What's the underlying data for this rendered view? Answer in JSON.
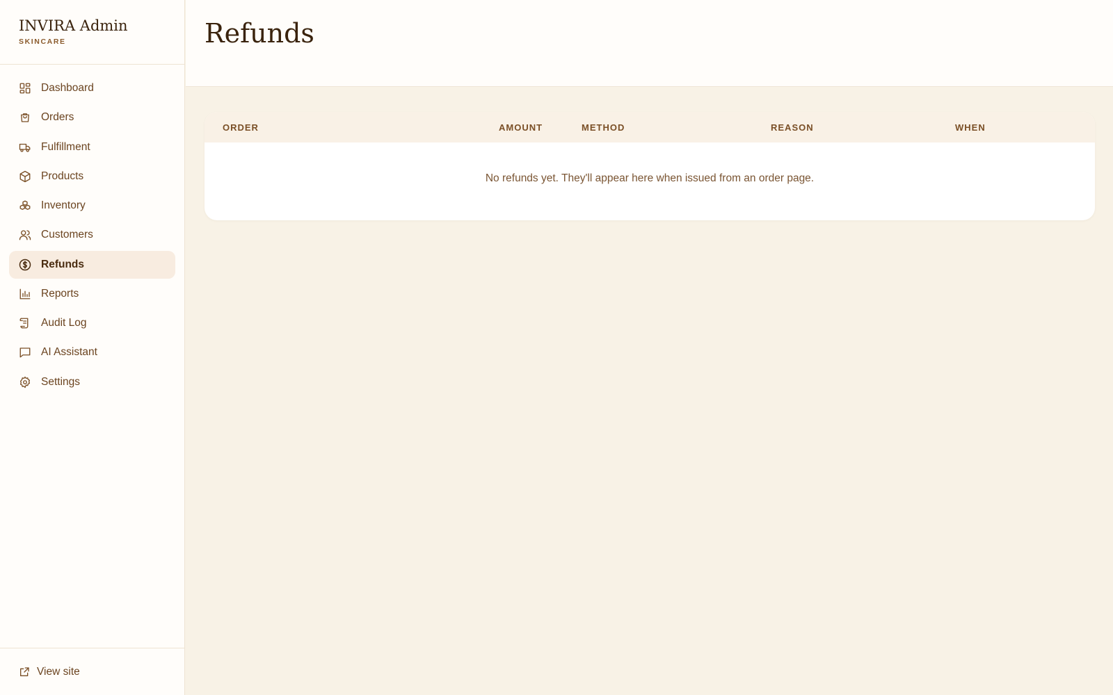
{
  "brand": {
    "title": "INVIRA Admin",
    "subtitle": "SKINCARE"
  },
  "nav": {
    "items": [
      {
        "label": "Dashboard",
        "icon": "dashboard-icon"
      },
      {
        "label": "Orders",
        "icon": "shopping-bag-icon"
      },
      {
        "label": "Fulfillment",
        "icon": "truck-icon"
      },
      {
        "label": "Products",
        "icon": "box-icon"
      },
      {
        "label": "Inventory",
        "icon": "boxes-icon"
      },
      {
        "label": "Customers",
        "icon": "users-icon"
      },
      {
        "label": "Refunds",
        "icon": "dollar-circle-icon",
        "active": true
      },
      {
        "label": "Reports",
        "icon": "bar-chart-icon"
      },
      {
        "label": "Audit Log",
        "icon": "scroll-icon"
      },
      {
        "label": "AI Assistant",
        "icon": "message-icon"
      },
      {
        "label": "Settings",
        "icon": "gear-icon"
      }
    ]
  },
  "footer": {
    "view_site_label": "View site",
    "icon": "external-link-icon"
  },
  "page": {
    "title": "Refunds"
  },
  "table": {
    "columns": [
      "ORDER",
      "AMOUNT",
      "METHOD",
      "REASON",
      "WHEN"
    ],
    "empty_message": "No refunds yet. They'll appear here when issued from an order page."
  },
  "colors": {
    "accent": "#8a5a2b",
    "active_bg": "#f8ece0",
    "page_bg": "#f8f2e6",
    "text": "#5c3d1e"
  }
}
